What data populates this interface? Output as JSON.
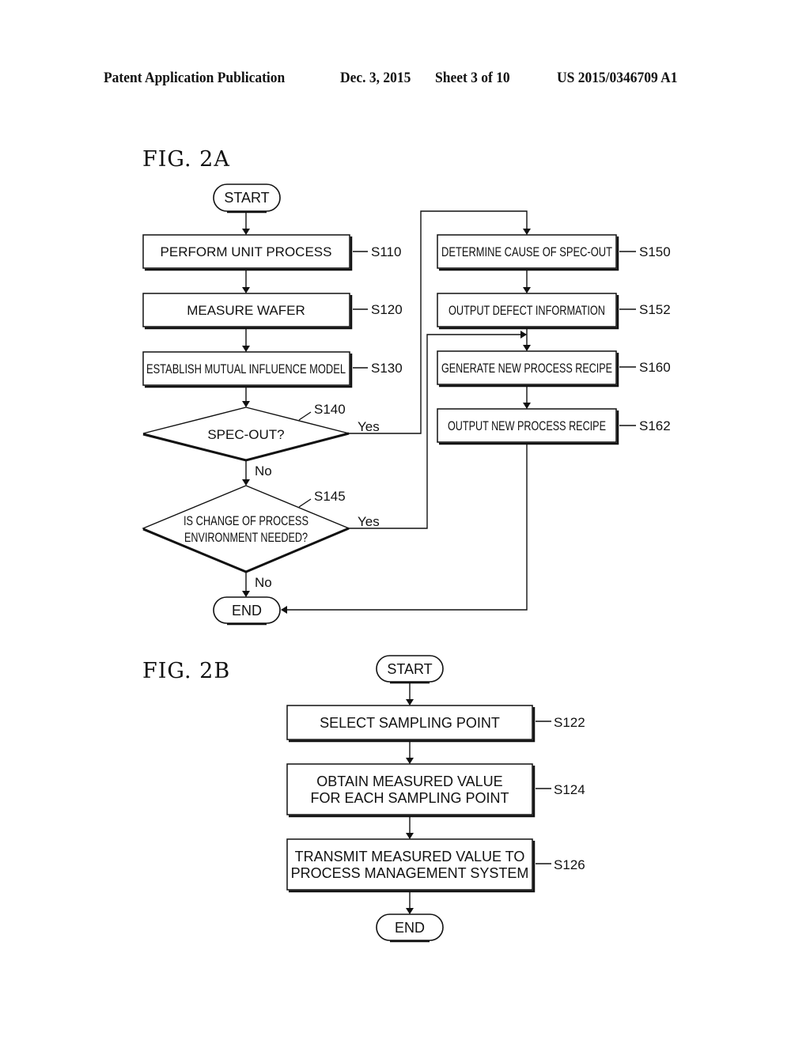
{
  "header": {
    "publication": "Patent Application Publication",
    "date": "Dec. 3, 2015",
    "sheet": "Sheet 3 of 10",
    "number": "US 2015/0346709 A1"
  },
  "fig2a": {
    "title": "FIG.  2A",
    "start": "START",
    "end": "END",
    "steps": [
      {
        "id": "S110",
        "text": "PERFORM UNIT PROCESS"
      },
      {
        "id": "S120",
        "text": "MEASURE WAFER"
      },
      {
        "id": "S130",
        "text": "ESTABLISH MUTUAL INFLUENCE MODEL"
      },
      {
        "id": "S150",
        "text": "DETERMINE CAUSE OF SPEC-OUT"
      },
      {
        "id": "S152",
        "text": "OUTPUT DEFECT INFORMATION"
      },
      {
        "id": "S160",
        "text": "GENERATE NEW PROCESS RECIPE"
      },
      {
        "id": "S162",
        "text": "OUTPUT NEW PROCESS RECIPE"
      }
    ],
    "decisions": [
      {
        "id": "S140",
        "lines": [
          "SPEC-OUT?"
        ],
        "yes": "Yes",
        "no": "No"
      },
      {
        "id": "S145",
        "lines": [
          "IS CHANGE OF PROCESS",
          "ENVIRONMENT NEEDED?"
        ],
        "yes": "Yes",
        "no": "No"
      }
    ]
  },
  "fig2b": {
    "title": "FIG.  2B",
    "start": "START",
    "end": "END",
    "steps": [
      {
        "id": "S122",
        "lines": [
          "SELECT SAMPLING POINT"
        ]
      },
      {
        "id": "S124",
        "lines": [
          "OBTAIN MEASURED VALUE",
          "FOR EACH SAMPLING POINT"
        ]
      },
      {
        "id": "S126",
        "lines": [
          "TRANSMIT MEASURED VALUE TO",
          "PROCESS MANAGEMENT SYSTEM"
        ]
      }
    ]
  }
}
